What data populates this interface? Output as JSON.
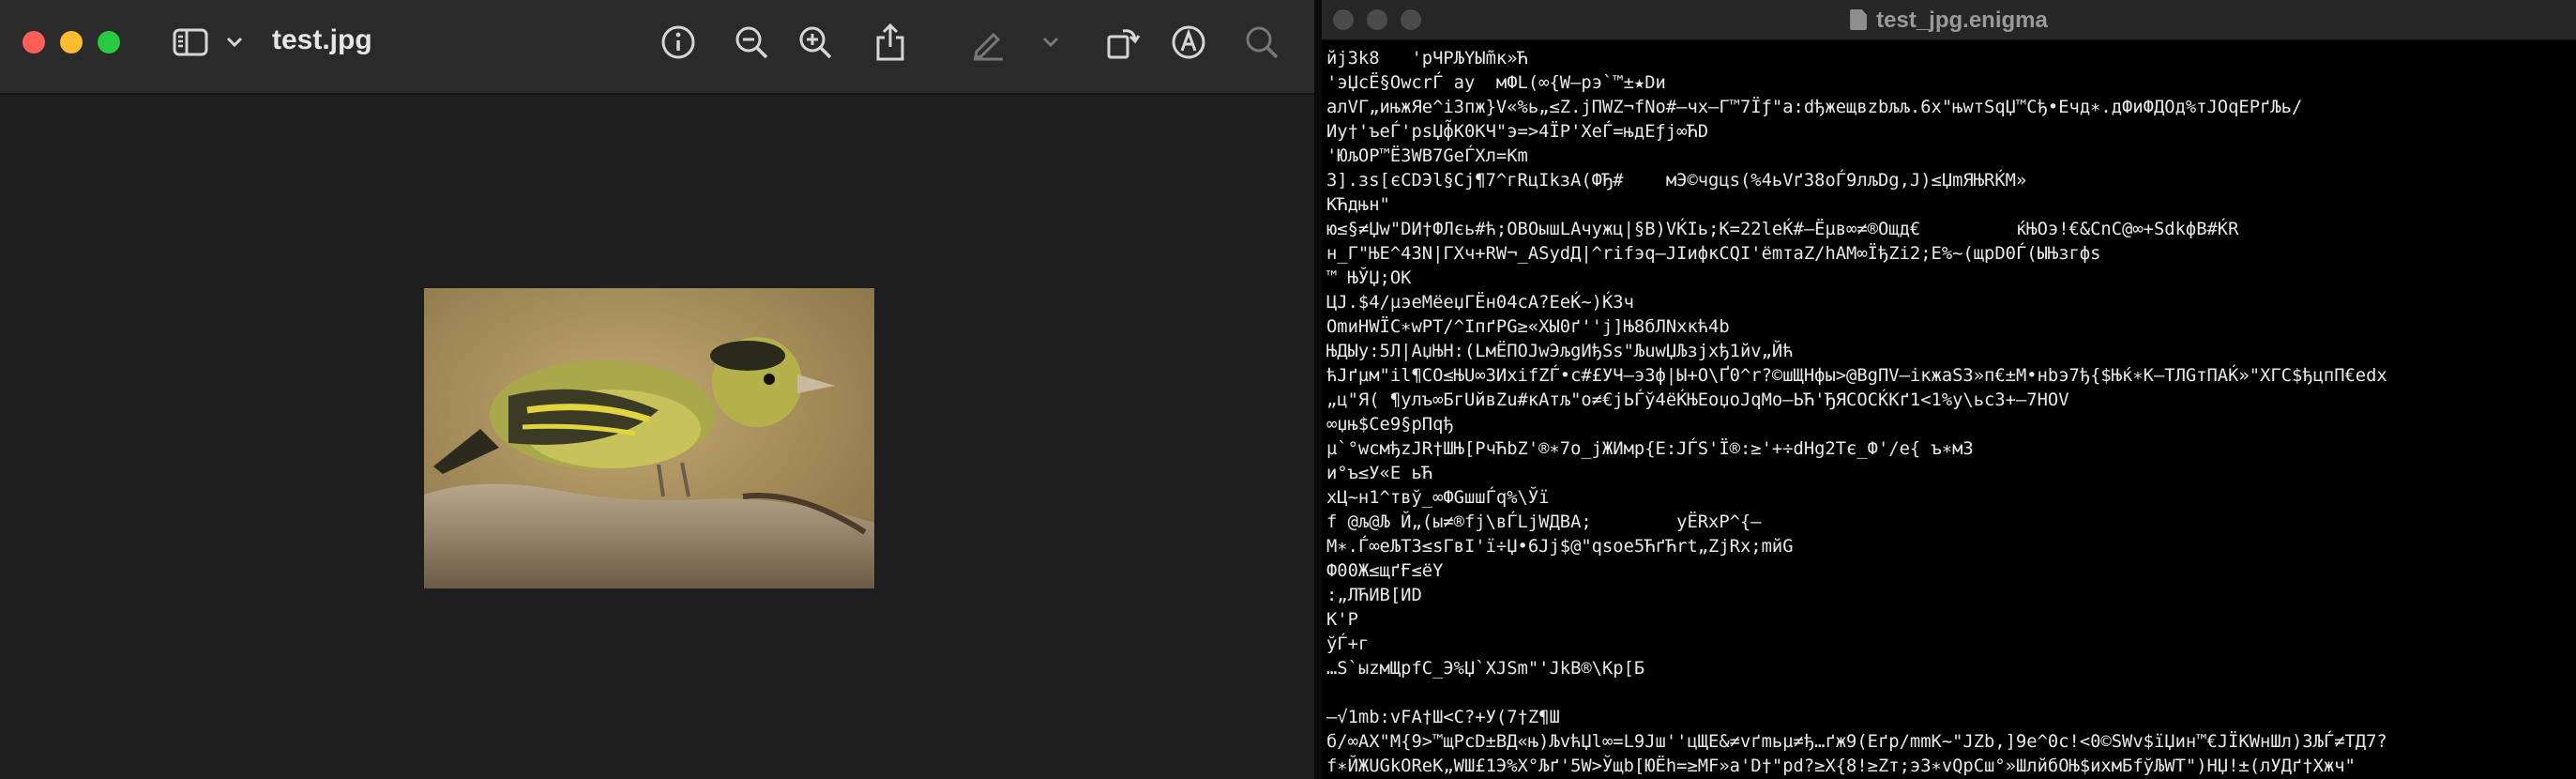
{
  "preview": {
    "title": "test.jpg",
    "toolbar": {
      "sidebar_toggle": "sidebar-icon",
      "chevron": "chevron-down-icon",
      "info": "info-icon",
      "zoom_out": "zoom-out-icon",
      "zoom_in": "zoom-in-icon",
      "share": "share-icon",
      "markup_pen": "pen-icon",
      "rotate": "rotate-icon",
      "annotate": "markup-icon",
      "search": "search-icon"
    },
    "image_subject": "bird-photo"
  },
  "editor": {
    "title": "test_jpg.enigma",
    "lines": [
      "йј3k8   'рЧРЉҮЫm̃к»Ћ",
      "'эЏсЁ§ОwсrЃ ау  мФL(∞{W—рэ`™±★Dи",
      "алVГ„ињжЯе^i3пж}V«%ь„≤Z.jПWZ¬fNo#—чх—Г™7Їƒ\"а:dђжещвzbљљ.6х\"њwтSqЏ™Сђ•Ечд∗.дФиФДОд%тJОqЕРґЉь/",
      "Иу†'ъеЃ'рsЏф̃К0КЧ\"э=>4ЇР'ХеЃ=њдЕƒј∞ЋD",
      "'ЮљОР™Ё3WB7GеЃХл=Кm",
      "3].зs[єCDЭl§Сј¶7^гRцІkзA(ФЂ#    мЭ©чgцs(%4ьVґ38оЃ9лљDg,J)≤ЏmЯЊRЌМ»",
      "КЋдњн\"",
      "ю≤§≠Џw\"DИ†ФЛєь#ћ;ОВОышLАчужц|§В)VЌIь;К=22lеЌ#—Ёµв∞≠®Ощд€         ќЊОэ!€&СnС@∞+SdkфB#ЌR",
      "н_Г\"ЊЕ^43N|ГХч+RW¬_ASydД|^rifэq—JIифкСQI'ёmтаZ/hАМ∞ЇђZi2;Е%~(щрD0Ѓ(ЫЊзгфѕ",
      "™ ЊЎЏ;OK",
      "ЦЈ.$4/µэеМёеџГЁн04сА?ЕеЌ~)Ќ3ч",
      "ОmиНWЇС∗wРТ/^ІпґРG≥«ХЫ0ґ''j]Њ8бЛNхкћ4b",
      "ЊДЫу:5Л|АџЊН:(LмЁПОJwЭљgИђSs\"ЉuwЏЉзjхђ1йv„Йћ",
      "ћJґµм\"il¶СО≤ЊU∞ЗИхifZЃ•с#£УЧ—э3ф|Ы+О\\Ґ0^r?©шЩНфы>@ВgПV—ікжаS3»п€±М•нbэ7ђ{$Њќ∗К—ТЛGтПАЌ»\"ХГС$ђцпП€еdх",
      "„ц\"Я( ¶улъ∞БгUйвZu#кАтљ\"о≠€јЬЃў4ёЌЊЕоџоJqМо—ЬЋ'ЂЯСОСЌКґ1<1%у\\ьс3+—7HOV",
      "∞џњ$Се9§рПqђ",
      "µ`°wсмђzJR†ШЊ[РчЋbZ'®∗7о_jЖИмр{Е:JЃS'Ї®:≥'+÷dHg2Тє_Ф'/е{ ъ∗м3",
      "и°ъ≤У«Е ьЋ",
      "хЦ~н1^твў_∞ФGшшЃq%\\Ўї",
      "f @љ@Љ Й„(ы≠®fј\\вЃLjWДВА;        уЁRхР^{—",
      "М∗.Ѓ∞еЉТ3≤sГвІ'ї÷Џ•6Јј$@\"qsoе5ЋґЋrt„ZjRx;mйG",
      "Ф00Ж≤щґҒ≤ёҮ",
      ":„ЛЋИВ[ИD",
      "К'Р",
      "ўЃ+г",
      "…S`ыzмЩрfС_Э%Џ`XJSm\"'JkВ®\\Кр[Б",
      "",
      "—√1mb:vFА†Ш<С?+У(7†Z¶Ш",
      "б/∞АХ\"М{9>™щРсD±ВД«њ)ЉvћЏl∞=L9Jш''цЩЕ&≠vґmьµ≠ђ…ґж9(Еґр/mmК~\"JZb,]9е^0с!<0©SWv$їЏин™€JЇКWнШл)ЗЉЃ≠ТД7?",
      "f∗ЙЖUGkОReK„WШ£1Э%Х°Љґ'5W>Ўщb[ЮЁh=≥МF»а'D†\"рd?≥Х{8!≥Zт;э3∗vQрСш°»ШлйбОЊ$ихмБfўЉWТ\")НЏ!±(лУДґ†Хжч\""
    ]
  }
}
